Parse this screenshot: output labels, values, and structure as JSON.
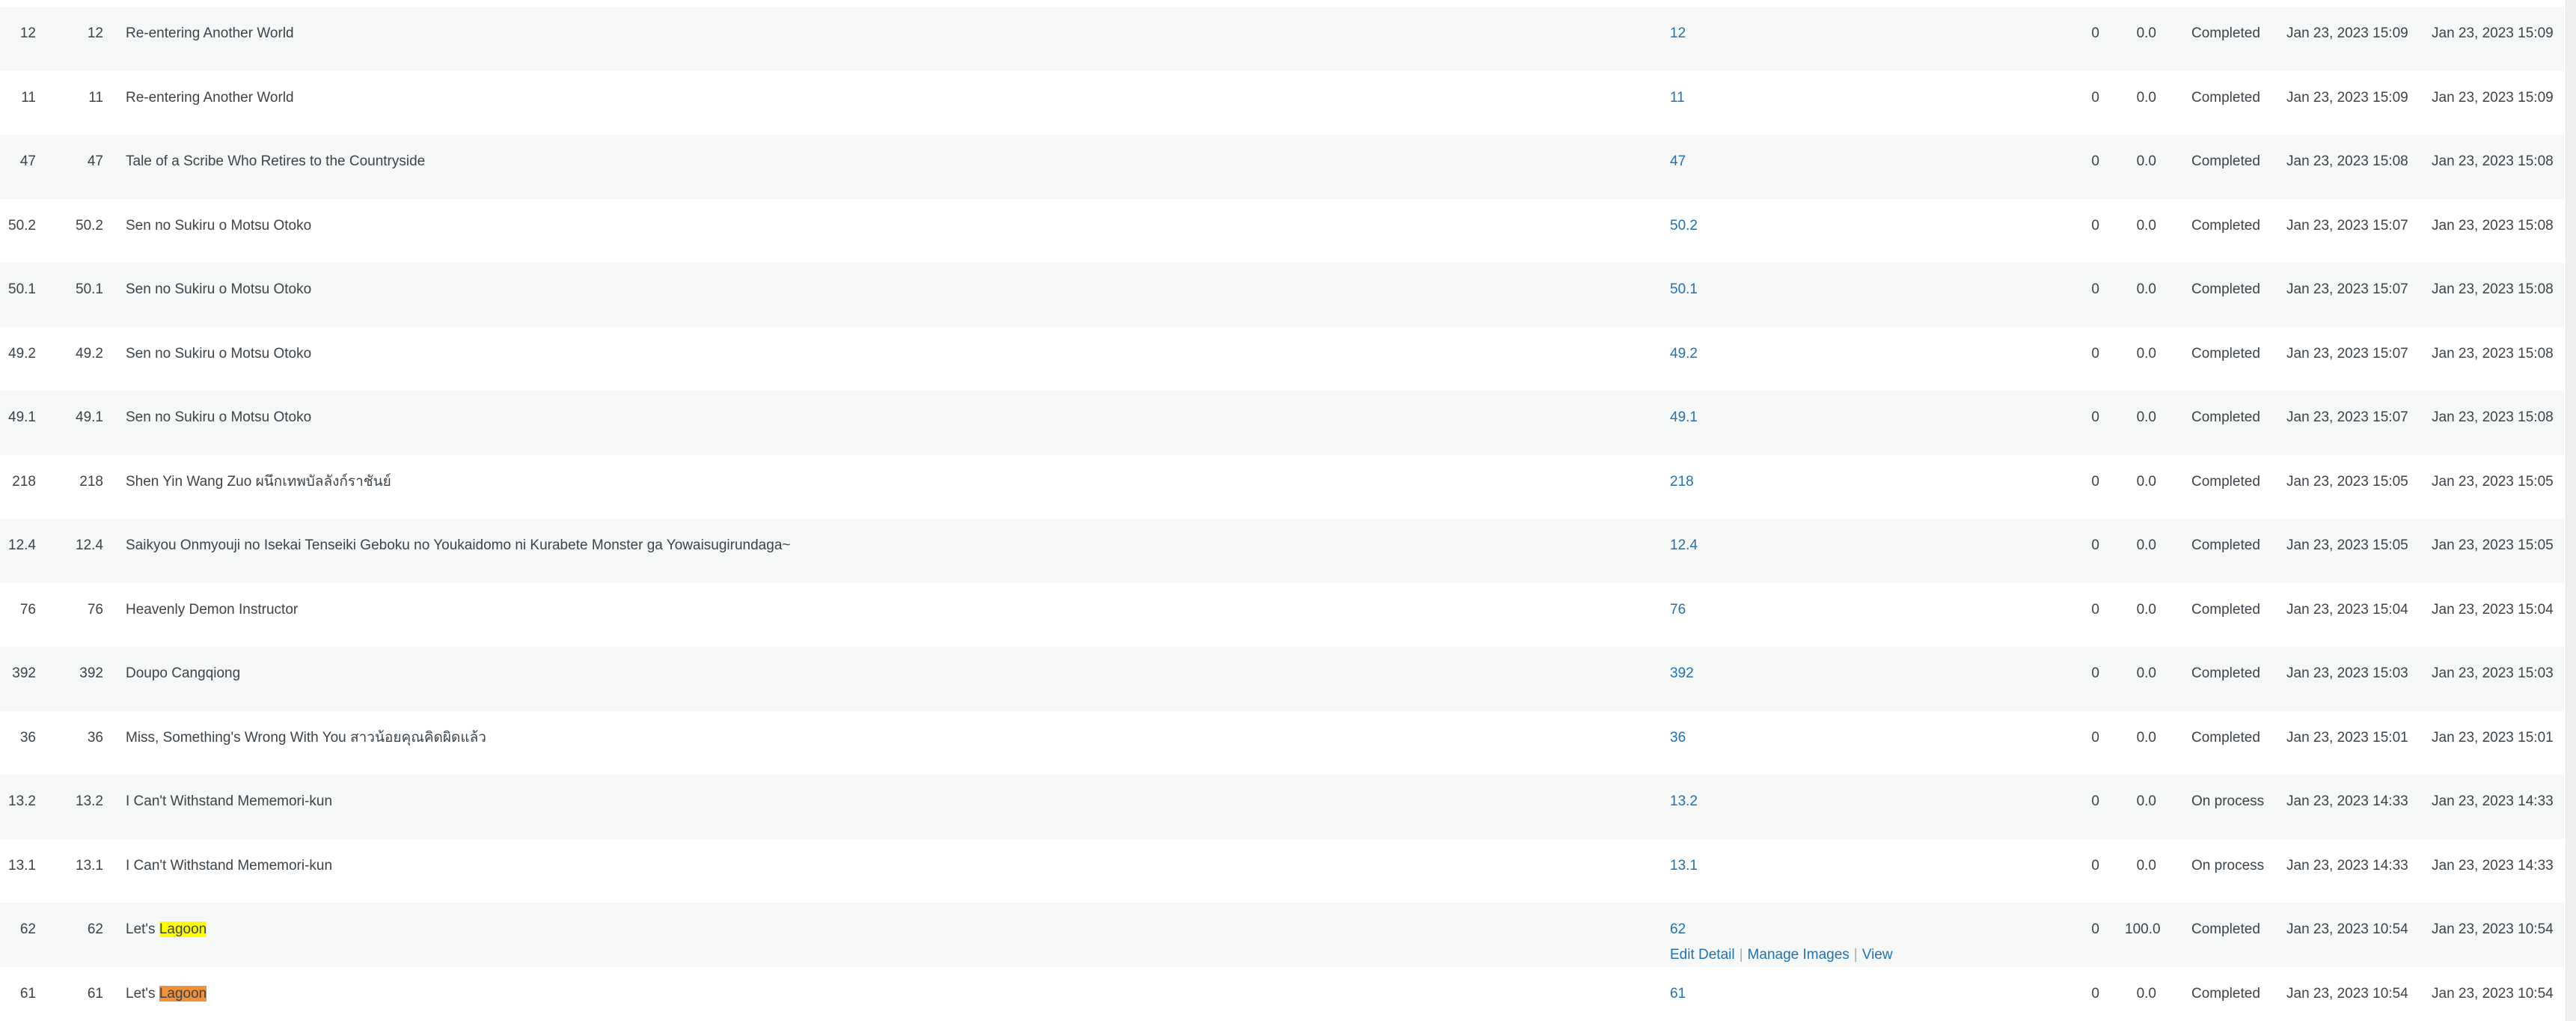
{
  "rows": [
    {
      "id": "12",
      "num": "12",
      "title": "Re-entering Another World",
      "chapter": "12",
      "views": "0",
      "rating": "0.0",
      "status": "Completed",
      "created": "Jan 23, 2023 15:09",
      "updated": "Jan 23, 2023 15:09"
    },
    {
      "id": "11",
      "num": "11",
      "title": "Re-entering Another World",
      "chapter": "11",
      "views": "0",
      "rating": "0.0",
      "status": "Completed",
      "created": "Jan 23, 2023 15:09",
      "updated": "Jan 23, 2023 15:09"
    },
    {
      "id": "47",
      "num": "47",
      "title": "Tale of a Scribe Who Retires to the Countryside",
      "chapter": "47",
      "views": "0",
      "rating": "0.0",
      "status": "Completed",
      "created": "Jan 23, 2023 15:08",
      "updated": "Jan 23, 2023 15:08"
    },
    {
      "id": "50.2",
      "num": "50.2",
      "title": "Sen no Sukiru o Motsu Otoko",
      "chapter": "50.2",
      "views": "0",
      "rating": "0.0",
      "status": "Completed",
      "created": "Jan 23, 2023 15:07",
      "updated": "Jan 23, 2023 15:08"
    },
    {
      "id": "50.1",
      "num": "50.1",
      "title": "Sen no Sukiru o Motsu Otoko",
      "chapter": "50.1",
      "views": "0",
      "rating": "0.0",
      "status": "Completed",
      "created": "Jan 23, 2023 15:07",
      "updated": "Jan 23, 2023 15:08"
    },
    {
      "id": "49.2",
      "num": "49.2",
      "title": "Sen no Sukiru o Motsu Otoko",
      "chapter": "49.2",
      "views": "0",
      "rating": "0.0",
      "status": "Completed",
      "created": "Jan 23, 2023 15:07",
      "updated": "Jan 23, 2023 15:08"
    },
    {
      "id": "49.1",
      "num": "49.1",
      "title": "Sen no Sukiru o Motsu Otoko",
      "chapter": "49.1",
      "views": "0",
      "rating": "0.0",
      "status": "Completed",
      "created": "Jan 23, 2023 15:07",
      "updated": "Jan 23, 2023 15:08"
    },
    {
      "id": "218",
      "num": "218",
      "title": "Shen Yin Wang Zuo ผนึกเทพบัลลังก์ราชันย์",
      "chapter": "218",
      "views": "0",
      "rating": "0.0",
      "status": "Completed",
      "created": "Jan 23, 2023 15:05",
      "updated": "Jan 23, 2023 15:05"
    },
    {
      "id": "12.4",
      "num": "12.4",
      "title": "Saikyou Onmyouji no Isekai Tenseiki Geboku no Youkaidomo ni Kurabete Monster ga Yowaisugirundaga~",
      "chapter": "12.4",
      "views": "0",
      "rating": "0.0",
      "status": "Completed",
      "created": "Jan 23, 2023 15:05",
      "updated": "Jan 23, 2023 15:05"
    },
    {
      "id": "76",
      "num": "76",
      "title": "Heavenly Demon Instructor",
      "chapter": "76",
      "views": "0",
      "rating": "0.0",
      "status": "Completed",
      "created": "Jan 23, 2023 15:04",
      "updated": "Jan 23, 2023 15:04"
    },
    {
      "id": "392",
      "num": "392",
      "title": "Doupo Cangqiong",
      "chapter": "392",
      "views": "0",
      "rating": "0.0",
      "status": "Completed",
      "created": "Jan 23, 2023 15:03",
      "updated": "Jan 23, 2023 15:03"
    },
    {
      "id": "36",
      "num": "36",
      "title": "Miss, Something's Wrong With You สาวน้อยคุณคิดผิดแล้ว",
      "chapter": "36",
      "views": "0",
      "rating": "0.0",
      "status": "Completed",
      "created": "Jan 23, 2023 15:01",
      "updated": "Jan 23, 2023 15:01"
    },
    {
      "id": "13.2",
      "num": "13.2",
      "title": "I Can't Withstand Mememori-kun",
      "chapter": "13.2",
      "views": "0",
      "rating": "0.0",
      "status": "On process",
      "created": "Jan 23, 2023 14:33",
      "updated": "Jan 23, 2023 14:33"
    },
    {
      "id": "13.1",
      "num": "13.1",
      "title": "I Can't Withstand Mememori-kun",
      "chapter": "13.1",
      "views": "0",
      "rating": "0.0",
      "status": "On process",
      "created": "Jan 23, 2023 14:33",
      "updated": "Jan 23, 2023 14:33"
    },
    {
      "id": "62",
      "num": "62",
      "title_prefix": "Let's ",
      "title_highlight": "Lagoon",
      "highlight_color": "#ffff00",
      "chapter": "62",
      "views": "0",
      "rating": "100.0",
      "status": "Completed",
      "created": "Jan 23, 2023 10:54",
      "updated": "Jan 23, 2023 10:54"
    },
    {
      "id": "61",
      "num": "61",
      "title_prefix": "Let's ",
      "title_highlight": "Lagoon",
      "highlight_color": "#f0923b",
      "chapter": "61",
      "views": "0",
      "rating": "0.0",
      "status": "Completed",
      "created": "Jan 23, 2023 10:54",
      "updated": "Jan 23, 2023 10:54"
    }
  ],
  "row_actions": {
    "edit_detail": "Edit Detail",
    "manage_images": "Manage Images",
    "view": "View",
    "separator": "|"
  },
  "colors": {
    "link": "#2271b1",
    "text": "#3c434a",
    "alt_row": "#f6f7f7"
  }
}
